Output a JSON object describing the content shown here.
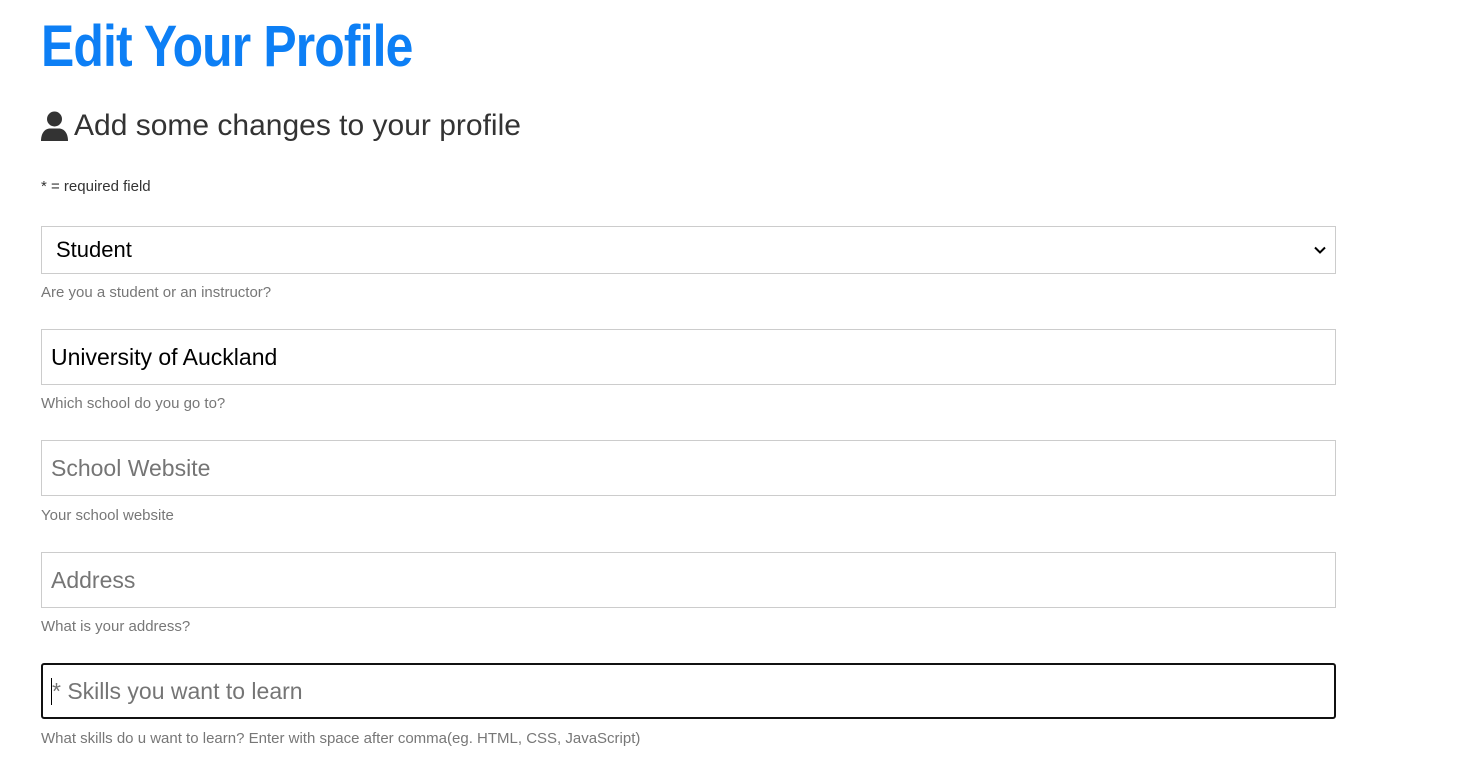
{
  "page": {
    "title": "Edit Your Profile",
    "subtitle": "Add some changes to your profile",
    "required_note": "* = required field"
  },
  "form": {
    "role": {
      "selected": "Student",
      "help": "Are you a student or an instructor?"
    },
    "school": {
      "value": "University of Auckland",
      "help": "Which school do you go to?"
    },
    "website": {
      "placeholder": "School Website",
      "help": "Your school website"
    },
    "address": {
      "placeholder": "Address",
      "help": "What is your address?"
    },
    "skills": {
      "placeholder": "* Skills you want to learn",
      "help": "What skills do u want to learn? Enter with space after comma(eg. HTML, CSS, JavaScript)"
    }
  },
  "icons": {
    "subtitle_icon": "user-icon",
    "select_icon": "chevron-down-icon"
  },
  "colors": {
    "title": "#0d7ff5",
    "text": "#333333",
    "help_text": "#777777",
    "field_border": "#cccccc",
    "focused_border": "#111111"
  }
}
